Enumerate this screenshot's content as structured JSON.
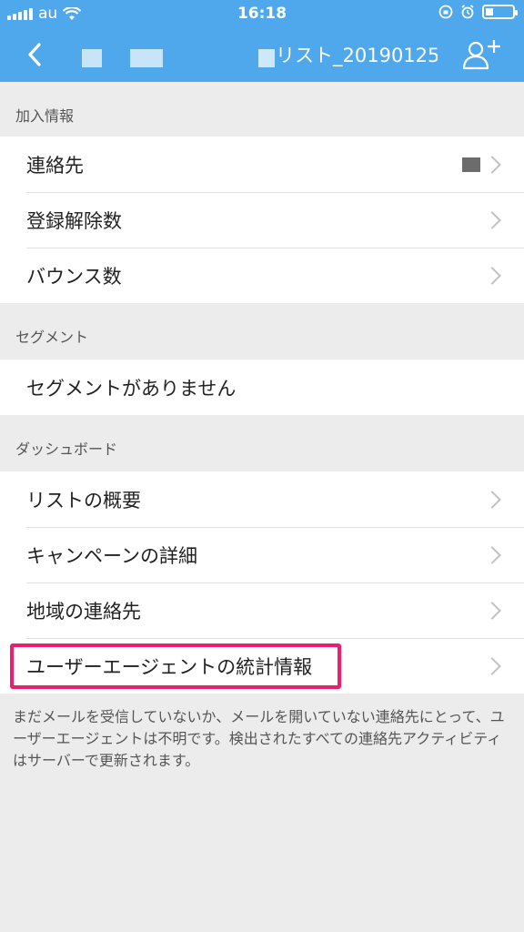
{
  "status_bar": {
    "carrier": "au",
    "time": "16:18"
  },
  "nav": {
    "title": "リスト_20190125",
    "back_icon": "chevron-left-icon",
    "add_icon": "add-user-icon"
  },
  "sections": [
    {
      "header": "加入情報",
      "items": [
        {
          "label": "連絡先"
        },
        {
          "label": "登録解除数"
        },
        {
          "label": "バウンス数"
        }
      ]
    },
    {
      "header": "セグメント",
      "items": [
        {
          "label": "セグメントがありません"
        }
      ]
    },
    {
      "header": "ダッシュボード",
      "items": [
        {
          "label": "リストの概要"
        },
        {
          "label": "キャンペーンの詳細"
        },
        {
          "label": "地域の連絡先"
        },
        {
          "label": "ユーザーエージェントの統計情報"
        }
      ]
    }
  ],
  "footnote": "まだメールを受信していないか、メールを開いていない連絡先にとって、ユーザーエージェントは不明です。検出されたすべての連絡先アクティビティはサーバーで更新されます。",
  "colors": {
    "header_bg": "#4fa8ec",
    "highlight": "#e8206e"
  }
}
